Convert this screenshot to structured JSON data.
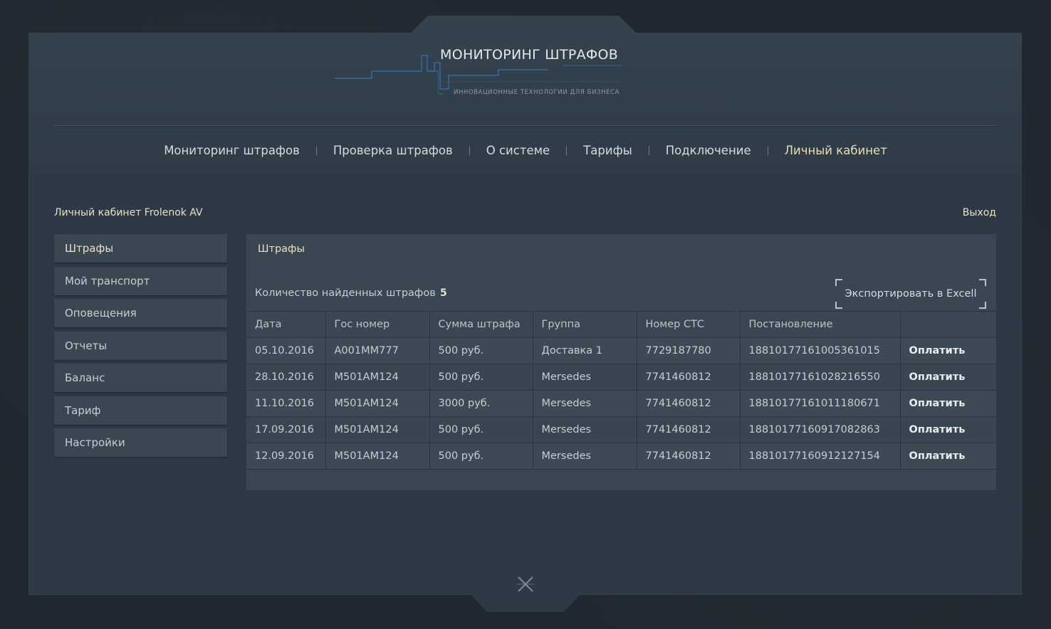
{
  "logo": {
    "title": "МОНИТОРИНГ ШТРАФОВ",
    "subtitle": "ИННОВАЦИОННЫЕ ТЕХНОЛОГИИ ДЛЯ БИЗНЕСА",
    "accent_color": "#2f7bc4"
  },
  "nav": {
    "items": [
      {
        "label": "Мониторинг штрафов"
      },
      {
        "label": "Проверка штрафов"
      },
      {
        "label": "О системе"
      },
      {
        "label": "Тарифы"
      },
      {
        "label": "Подключение"
      },
      {
        "label": "Личный кабинет",
        "active": true
      }
    ]
  },
  "cabinet": {
    "title": "Личный кабинет Frolenok AV",
    "logout_label": "Выход"
  },
  "sidebar": {
    "items": [
      {
        "label": "Штрафы",
        "active": true
      },
      {
        "label": "Мой транспорт"
      },
      {
        "label": "Оповещения"
      },
      {
        "label": "Отчеты"
      },
      {
        "label": "Баланс"
      },
      {
        "label": "Тариф"
      },
      {
        "label": "Настройки"
      }
    ]
  },
  "main": {
    "title": "Штрафы",
    "count_label": "Количество найденных штрафов",
    "count_value": "5",
    "export_label": "Экспортировать в Excell",
    "table": {
      "headers": [
        "Дата",
        "Гос номер",
        "Сумма штрафа",
        "Группа",
        "Номер СТС",
        "Постановление",
        ""
      ],
      "rows": [
        [
          "05.10.2016",
          "А001ММ777",
          "500 руб.",
          "Доставка 1",
          "7729187780",
          "18810177161005361015",
          "Оплатить"
        ],
        [
          "28.10.2016",
          "М501АМ124",
          "500 руб.",
          "Mersedes",
          "7741460812",
          "18810177161028216550",
          "Оплатить"
        ],
        [
          "11.10.2016",
          "М501АМ124",
          "3000 руб.",
          "Mersedes",
          "7741460812",
          "18810177161011180671",
          "Оплатить"
        ],
        [
          "17.09.2016",
          "М501АМ124",
          "500 руб.",
          "Mersedes",
          "7741460812",
          "18810177160917082863",
          "Оплатить"
        ],
        [
          "12.09.2016",
          "М501АМ124",
          "500 руб.",
          "Mersedes",
          "7741460812",
          "18810177160912127154",
          "Оплатить"
        ]
      ]
    }
  },
  "colors": {
    "background": "#1f2730",
    "panel": "#3a4652",
    "highlight_text": "#e8e0bc"
  }
}
